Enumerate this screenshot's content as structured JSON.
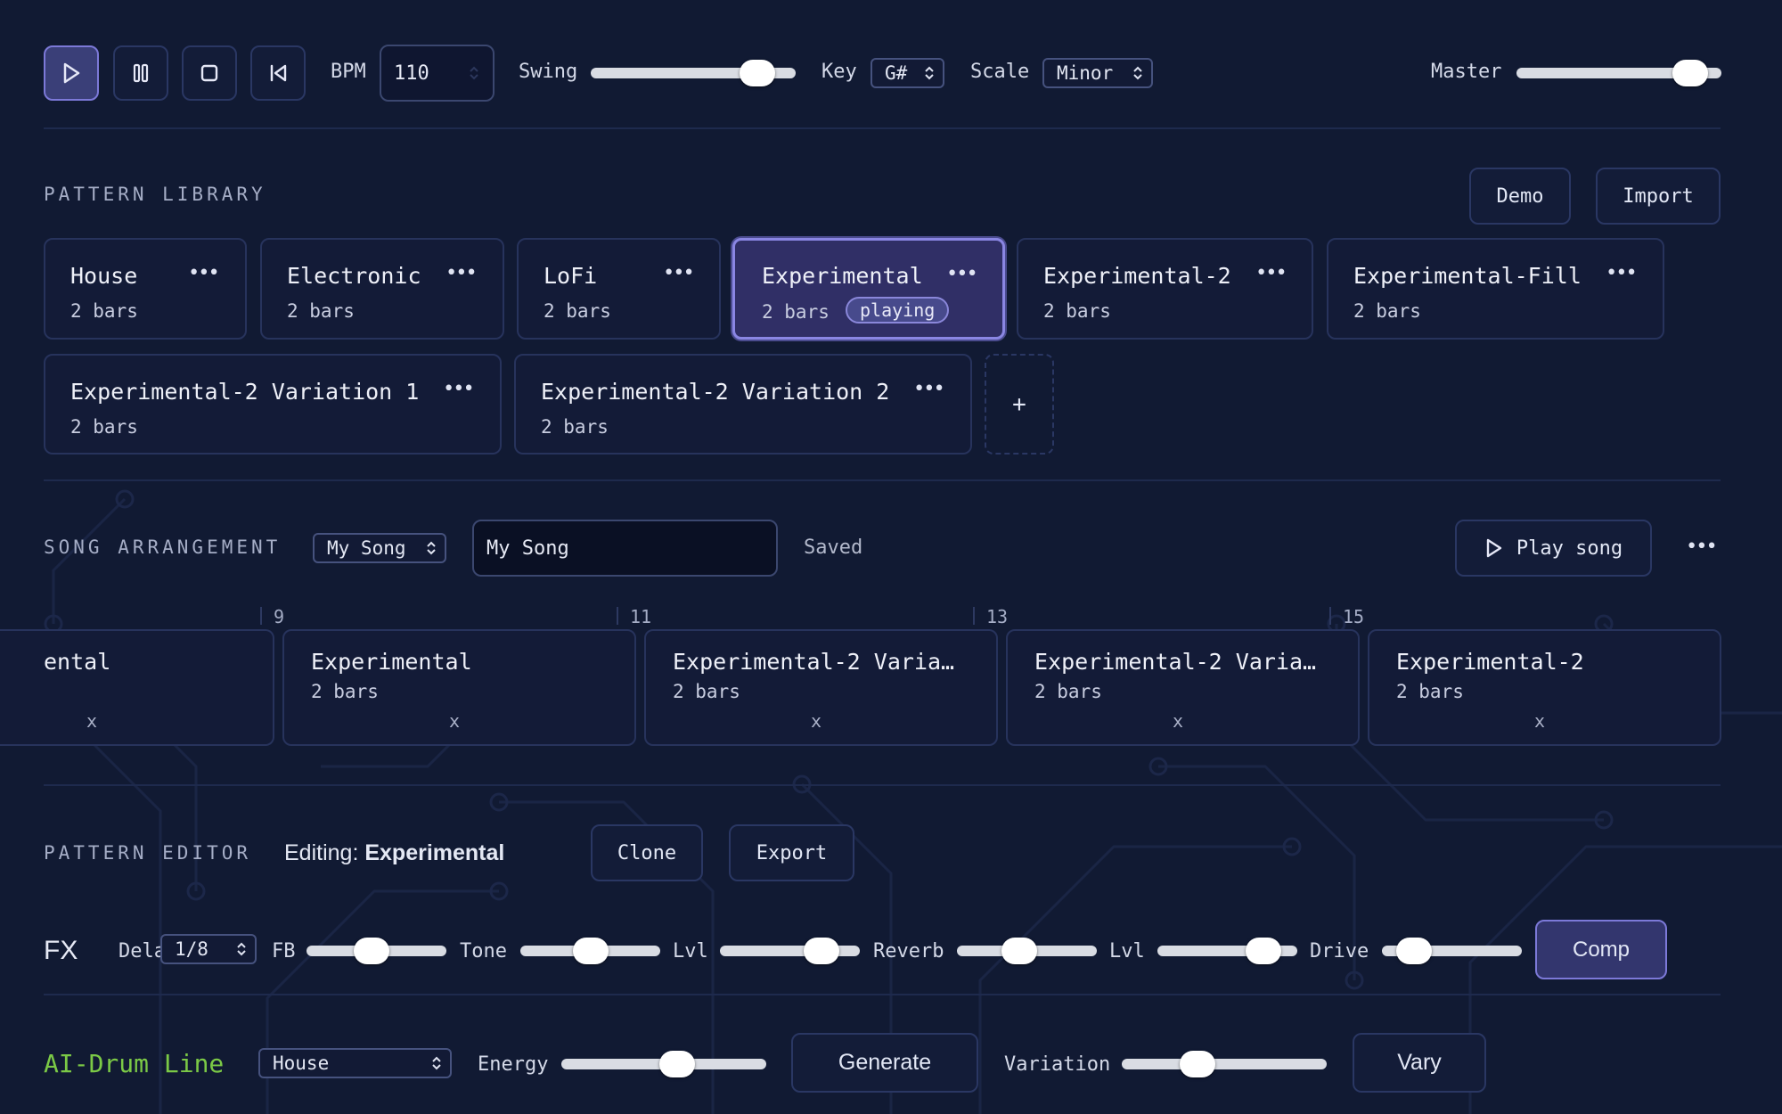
{
  "transport": {
    "bpm_label": "BPM",
    "bpm_value": "110",
    "swing_label": "Swing",
    "swing_value": 0.88,
    "key_label": "Key",
    "key_value": "G#",
    "scale_label": "Scale",
    "scale_value": "Minor",
    "master_label": "Master",
    "master_value": 0.92,
    "icons": [
      "play-icon",
      "pause-icon",
      "stop-icon",
      "skip-back-icon"
    ]
  },
  "library": {
    "title": "PATTERN LIBRARY",
    "demo_label": "Demo",
    "import_label": "Import",
    "add_label": "+",
    "playing_badge": "playing",
    "patterns": [
      {
        "name": "House",
        "bars": "2 bars"
      },
      {
        "name": "Electronic",
        "bars": "2 bars"
      },
      {
        "name": "LoFi",
        "bars": "2 bars"
      },
      {
        "name": "Experimental",
        "bars": "2 bars",
        "playing": true
      },
      {
        "name": "Experimental-2",
        "bars": "2 bars"
      },
      {
        "name": "Experimental-Fill",
        "bars": "2 bars"
      },
      {
        "name": "Experimental-2 Variation 1",
        "bars": "2 bars"
      },
      {
        "name": "Experimental-2 Variation 2",
        "bars": "2 bars"
      }
    ]
  },
  "song": {
    "title": "SONG ARRANGEMENT",
    "select_value": "My Song",
    "name_input": "My Song",
    "status": "Saved",
    "play_label": "Play song",
    "ticks": [
      "9",
      "11",
      "13",
      "15"
    ],
    "remove_label": "x",
    "blocks": [
      {
        "name": "ental",
        "bars": ""
      },
      {
        "name": "Experimental",
        "bars": "2 bars"
      },
      {
        "name": "Experimental-2 Varia…",
        "bars": "2 bars"
      },
      {
        "name": "Experimental-2 Varia…",
        "bars": "2 bars"
      },
      {
        "name": "Experimental-2",
        "bars": "2 bars"
      }
    ]
  },
  "editor": {
    "title": "PATTERN EDITOR",
    "editing_prefix": "Editing:",
    "editing_name": "Experimental",
    "clone_label": "Clone",
    "export_label": "Export"
  },
  "fx": {
    "title": "FX",
    "delay_label": "Delay",
    "delay_value": "1/8",
    "fb_label": "FB",
    "fb_value": 0.45,
    "tone_label": "Tone",
    "tone_value": 0.5,
    "lvl_label": "Lvl",
    "delay_lvl_value": 0.8,
    "reverb_label": "Reverb",
    "reverb_value": 0.43,
    "reverb_lvl_value": 0.85,
    "drive_label": "Drive",
    "drive_value": 0.14,
    "comp_label": "Comp"
  },
  "ai": {
    "title": "AI-Drum Line",
    "style_value": "House",
    "energy_label": "Energy",
    "energy_value": 0.58,
    "generate_label": "Generate",
    "variation_label": "Variation",
    "variation_value": 0.34,
    "vary_label": "Vary"
  },
  "colors": {
    "background": "#111a33",
    "accent": "#7c79d8",
    "ai_title": "#7bc946"
  }
}
